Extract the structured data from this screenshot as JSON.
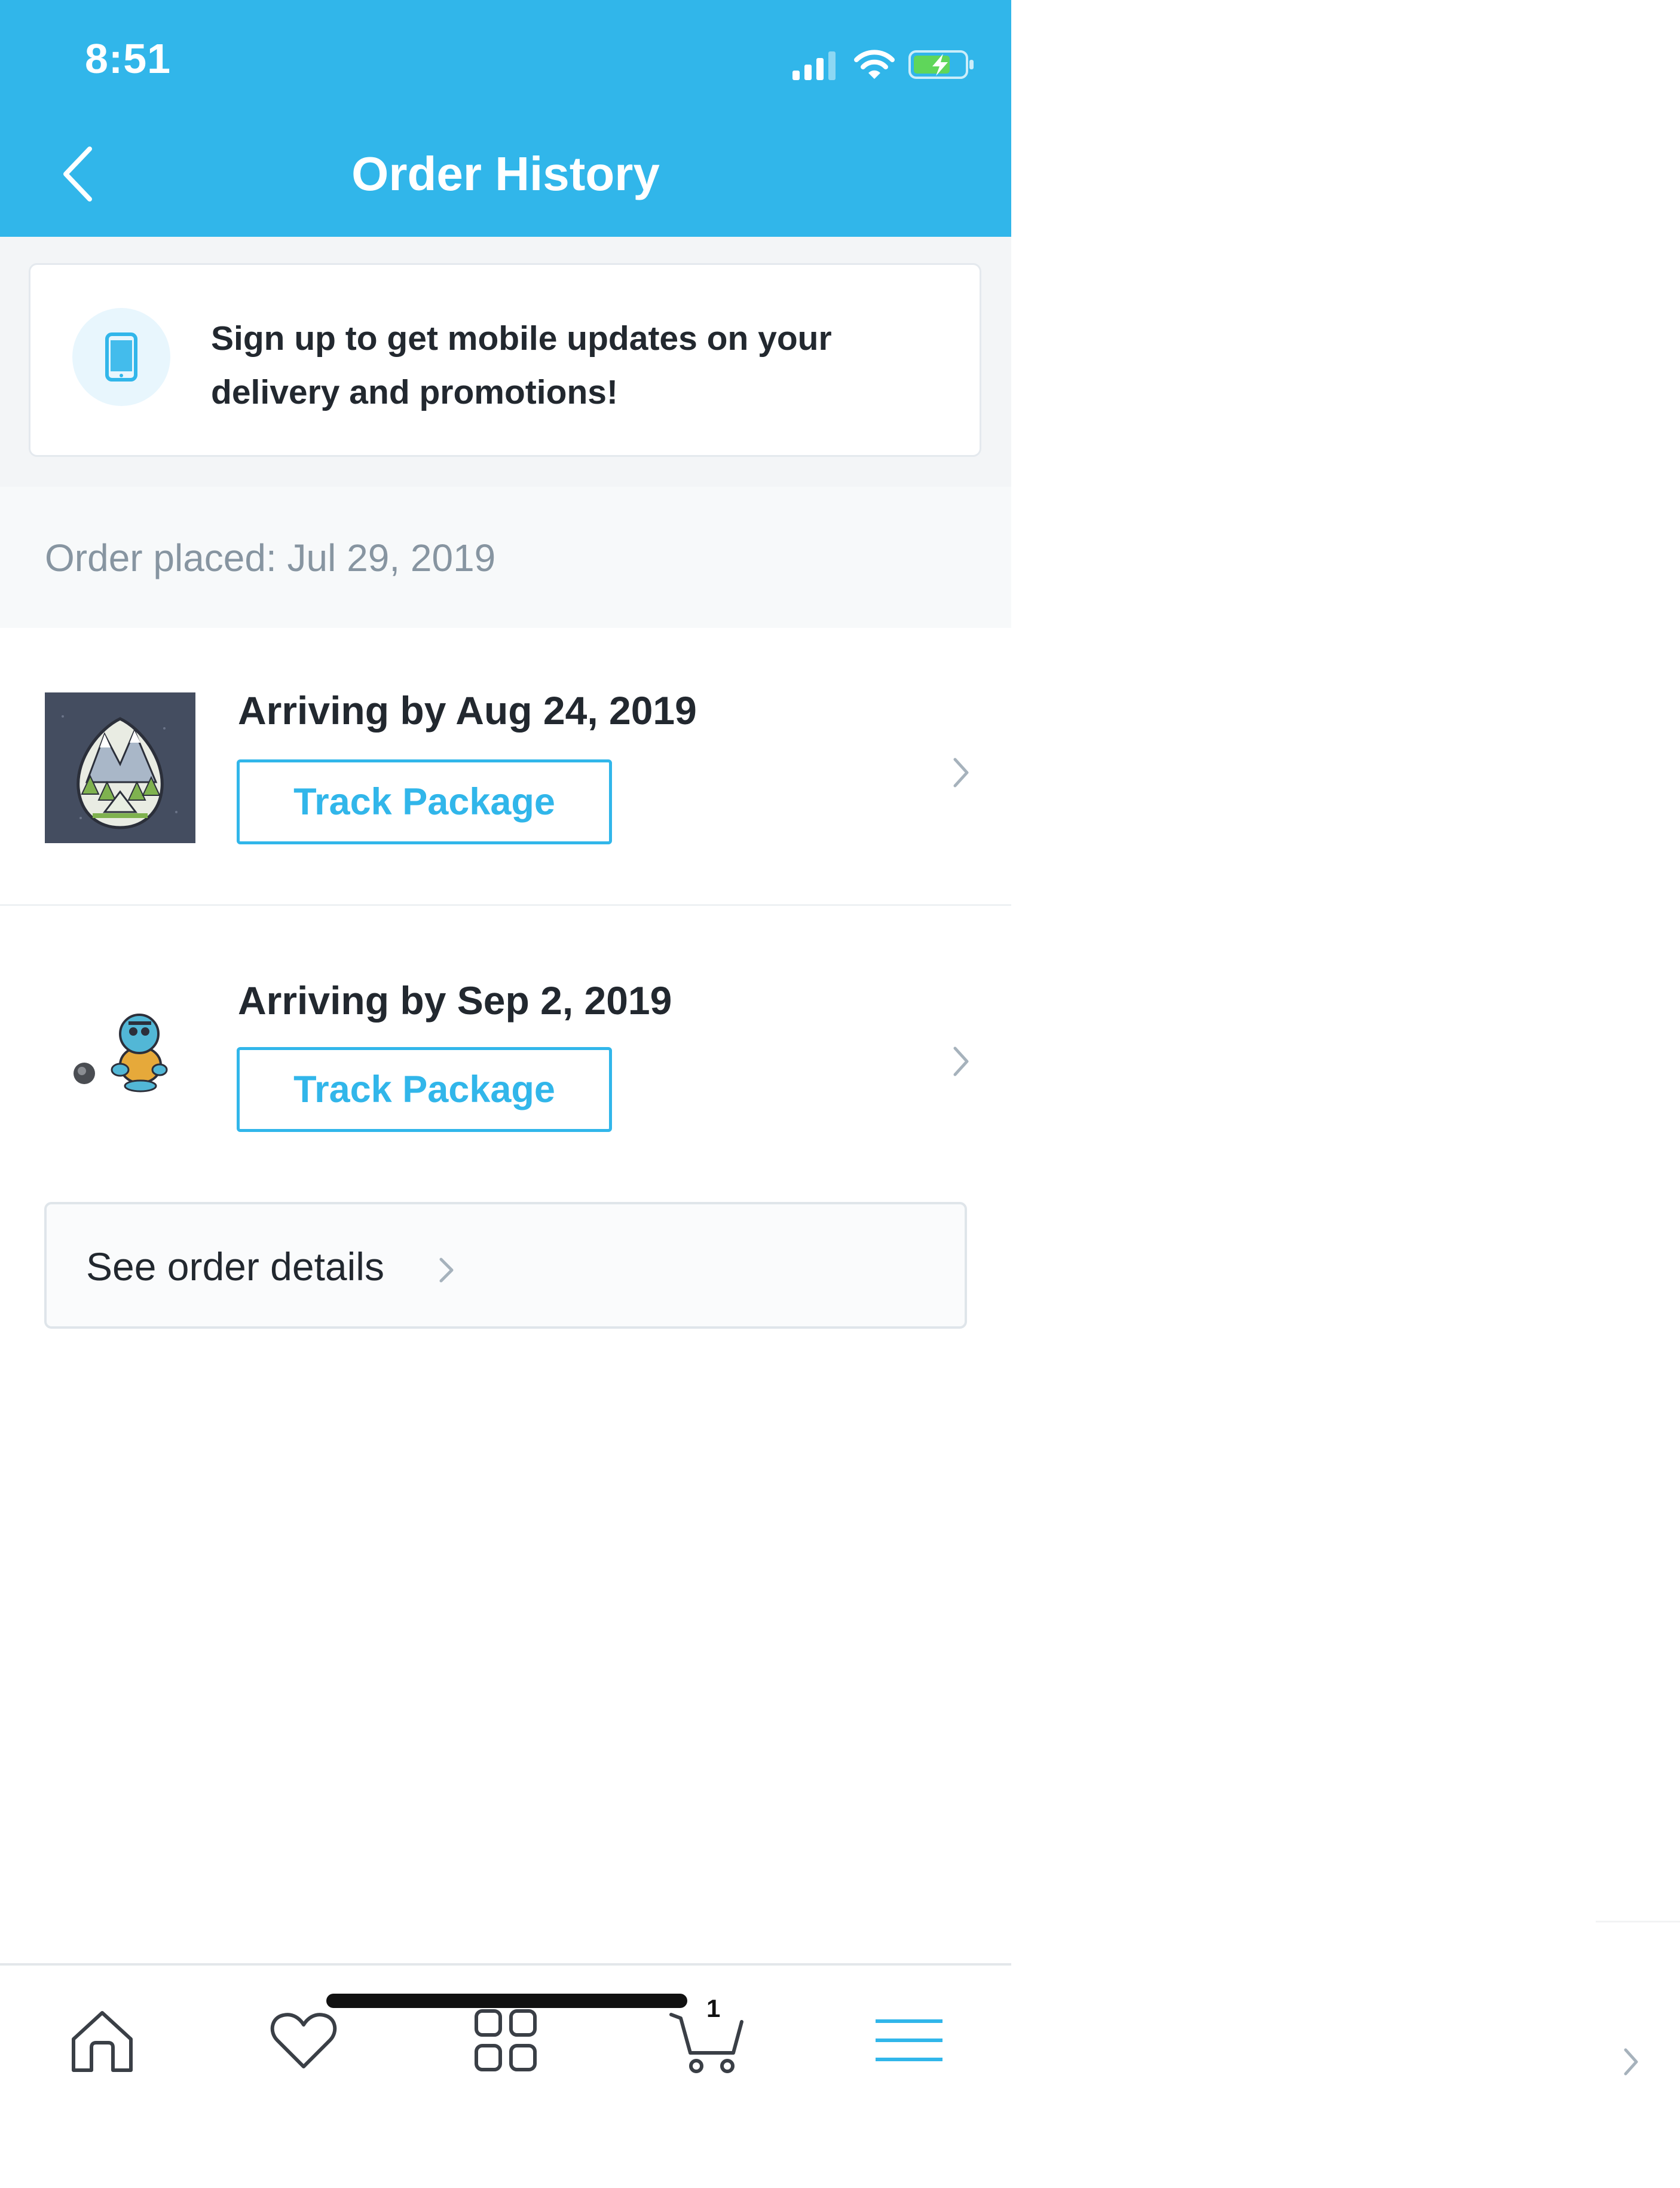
{
  "status_bar": {
    "time": "8:51"
  },
  "header": {
    "title": "Order History"
  },
  "promo": {
    "text": "Sign up to get mobile updates on your delivery and promotions!"
  },
  "order": {
    "placed_label": "Order placed: Jul 29, 2019",
    "shipments": [
      {
        "arrival": "Arriving by Aug 24, 2019",
        "track_label": "Track Package",
        "thumbnail": "mountain-camping-enamel-pin"
      },
      {
        "arrival": "Arriving by Sep 2, 2019",
        "track_label": "Track Package",
        "thumbnail": "squirtle-enamel-pin"
      }
    ],
    "details_label": "See order details"
  },
  "bottom_nav": {
    "items": [
      "home-icon",
      "heart-icon",
      "grid-icon",
      "cart-icon",
      "menu-icon"
    ],
    "cart_count": "1",
    "active": "menu-icon"
  },
  "colors": {
    "accent": "#31b6ea",
    "text": "#22282f",
    "muted": "#8795a1"
  }
}
